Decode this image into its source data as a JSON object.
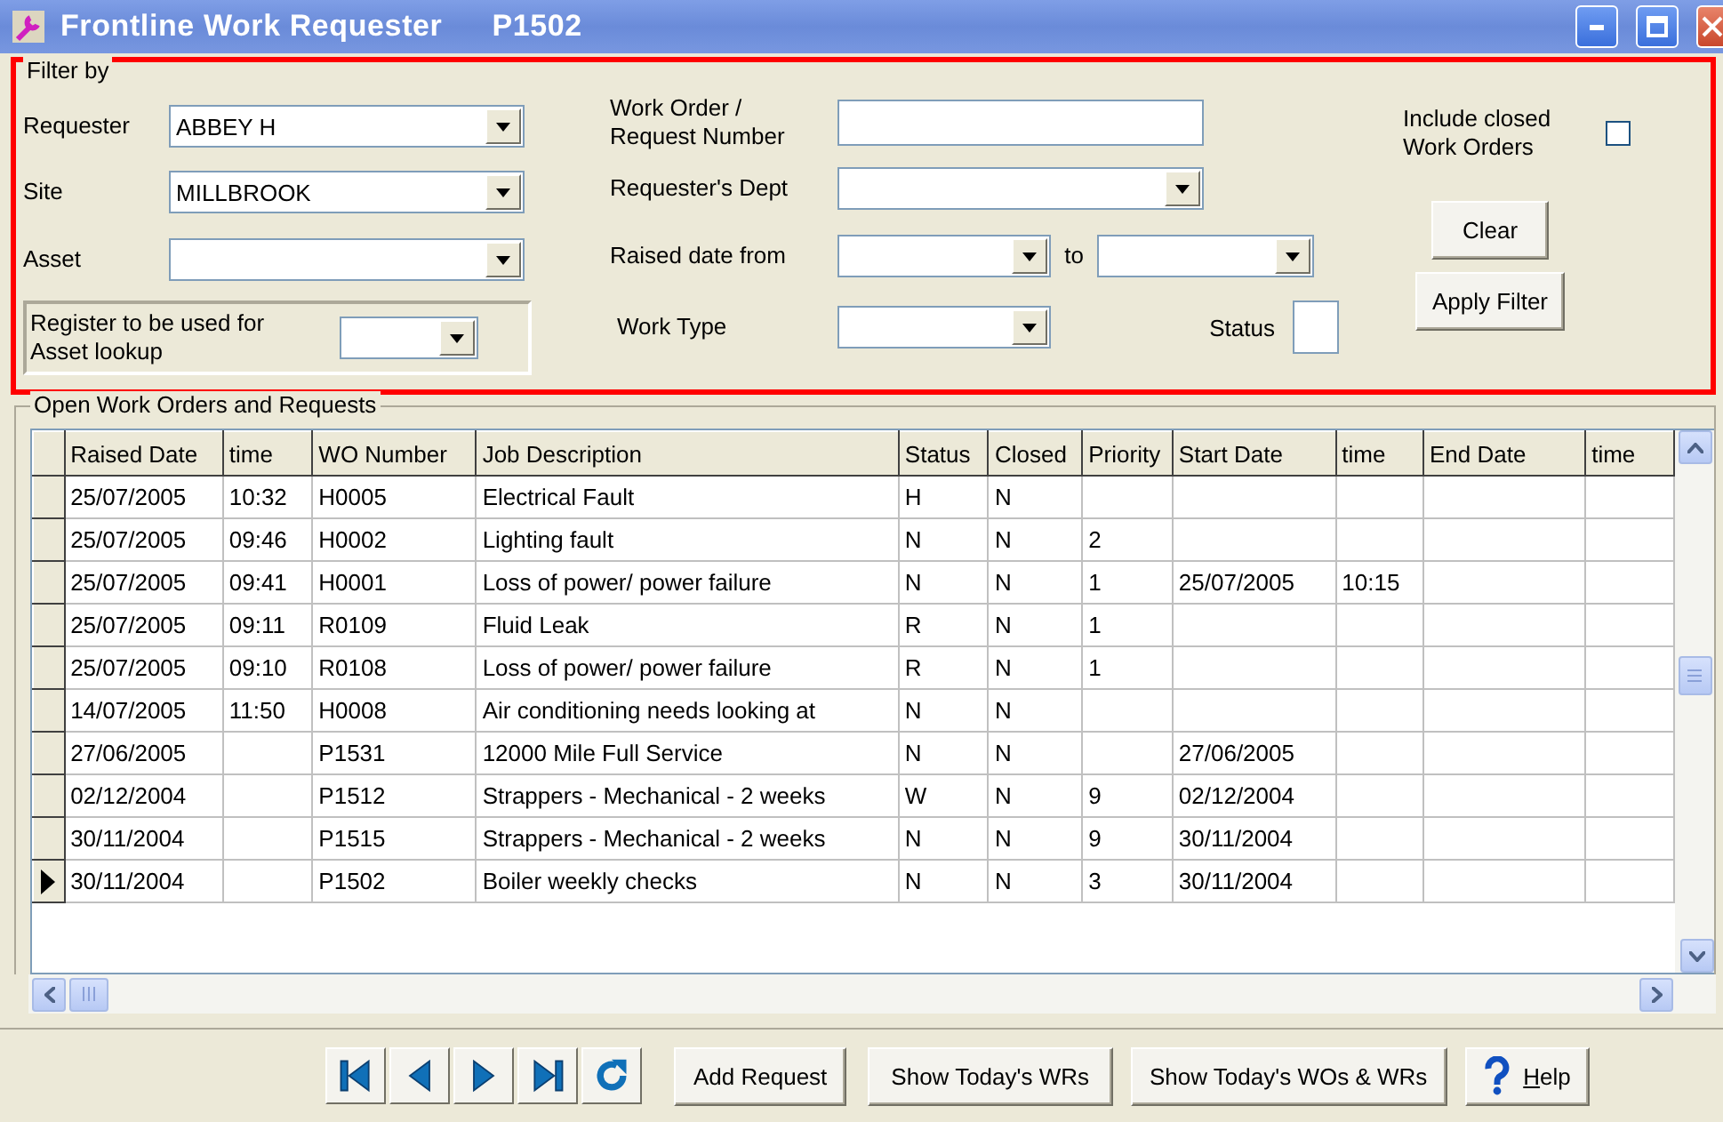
{
  "window": {
    "title": "Frontline Work Requester",
    "record": "P1502"
  },
  "filter": {
    "legend": "Filter by",
    "requester": {
      "label": "Requester",
      "value": "ABBEY H"
    },
    "site": {
      "label": "Site",
      "value": "MILLBROOK"
    },
    "asset": {
      "label": "Asset"
    },
    "register": {
      "label": "Register to be used for Asset lookup"
    },
    "work_order": {
      "label": "Work Order / Request Number"
    },
    "dept": {
      "label": "Requester's Dept"
    },
    "raised_from": {
      "label": "Raised date from"
    },
    "raised_to": {
      "label": "to"
    },
    "work_type": {
      "label": "Work Type"
    },
    "status": {
      "label": "Status"
    },
    "include_closed": {
      "label": "Include closed Work Orders",
      "checked": false
    },
    "buttons": [
      "Clear",
      "Apply Filter"
    ]
  },
  "grid": {
    "legend": "Open Work Orders and Requests",
    "columns": [
      "Raised Date",
      "time",
      "WO Number",
      "Job Description",
      "Status",
      "Closed",
      "Priority",
      "Start Date",
      "time",
      "End Date",
      "time"
    ],
    "rows": [
      {
        "selected": false,
        "cells": [
          "25/07/2005",
          "10:32",
          "H0005",
          "Electrical Fault",
          "H",
          "N",
          "",
          "",
          "",
          "",
          ""
        ]
      },
      {
        "selected": false,
        "cells": [
          "25/07/2005",
          "09:46",
          "H0002",
          "Lighting fault",
          "N",
          "N",
          "2",
          "",
          "",
          "",
          ""
        ]
      },
      {
        "selected": false,
        "cells": [
          "25/07/2005",
          "09:41",
          "H0001",
          "Loss of power/ power failure",
          "N",
          "N",
          "1",
          "25/07/2005",
          "10:15",
          "",
          ""
        ]
      },
      {
        "selected": false,
        "cells": [
          "25/07/2005",
          "09:11",
          "R0109",
          "Fluid Leak",
          "R",
          "N",
          "1",
          "",
          "",
          "",
          ""
        ]
      },
      {
        "selected": false,
        "cells": [
          "25/07/2005",
          "09:10",
          "R0108",
          "Loss of power/ power failure",
          "R",
          "N",
          "1",
          "",
          "",
          "",
          ""
        ]
      },
      {
        "selected": false,
        "cells": [
          "14/07/2005",
          "11:50",
          "H0008",
          "Air conditioning needs looking at",
          "N",
          "N",
          "",
          "",
          "",
          "",
          ""
        ]
      },
      {
        "selected": false,
        "cells": [
          "27/06/2005",
          "",
          "P1531",
          "12000 Mile Full Service",
          "N",
          "N",
          "",
          "27/06/2005",
          "",
          "",
          ""
        ]
      },
      {
        "selected": false,
        "cells": [
          "02/12/2004",
          "",
          "P1512",
          "Strappers - Mechanical - 2 weeks",
          "W",
          "N",
          "9",
          "02/12/2004",
          "",
          "",
          ""
        ]
      },
      {
        "selected": false,
        "cells": [
          "30/11/2004",
          "",
          "P1515",
          "Strappers - Mechanical - 2 weeks",
          "N",
          "N",
          "9",
          "30/11/2004",
          "",
          "",
          ""
        ]
      },
      {
        "selected": true,
        "cells": [
          "30/11/2004",
          "",
          "P1502",
          "Boiler weekly checks",
          "N",
          "N",
          "3",
          "30/11/2004",
          "",
          "",
          ""
        ]
      }
    ]
  },
  "toolbar": {
    "buttons": [
      "Add Request",
      "Show Today's WRs",
      "Show Today's WOs & WRs"
    ],
    "help": "Help"
  }
}
